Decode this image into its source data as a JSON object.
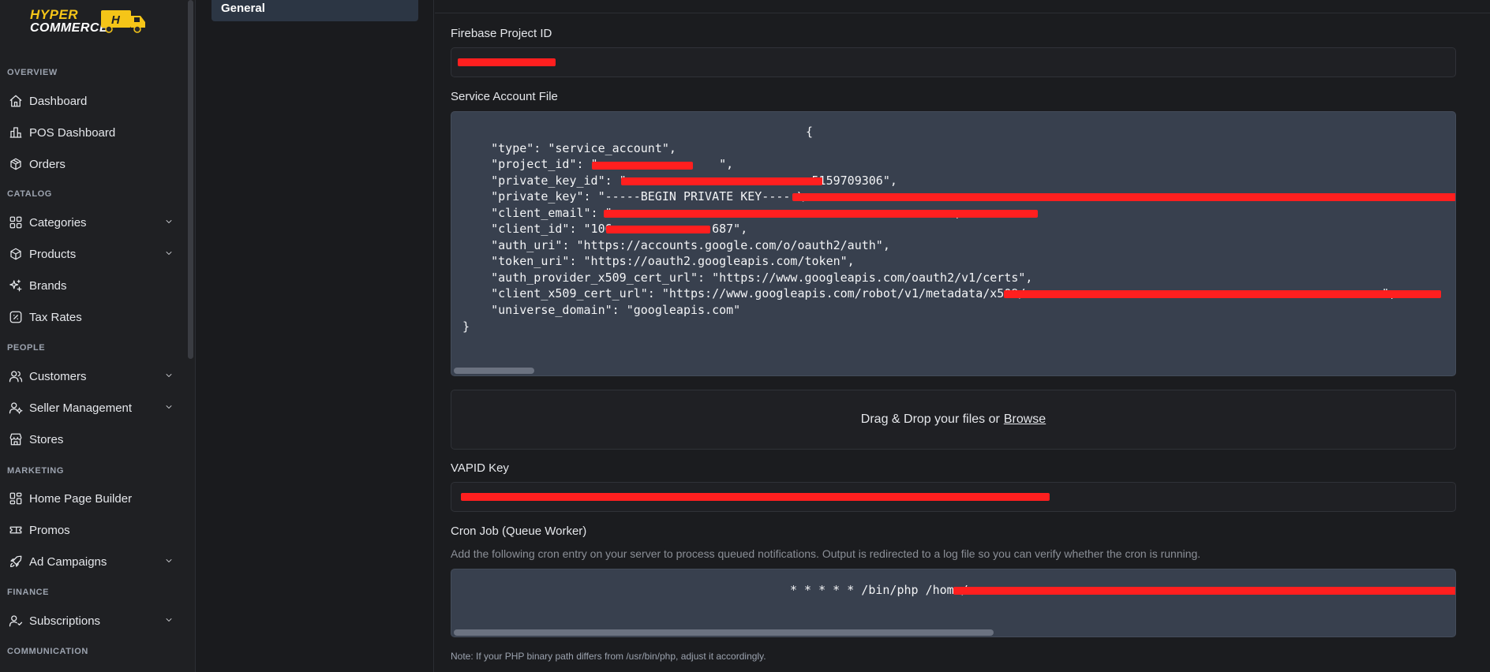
{
  "brand": {
    "line1": "HYPER",
    "line2": "COMMERCE",
    "truck_letter": "H"
  },
  "sidebar": {
    "sections": {
      "overview": "OVERVIEW",
      "catalog": "CATALOG",
      "people": "PEOPLE",
      "marketing": "MARKETING",
      "finance": "FINANCE",
      "communication": "COMMUNICATION"
    },
    "items": {
      "dashboard": "Dashboard",
      "pos_dashboard": "POS Dashboard",
      "orders": "Orders",
      "categories": "Categories",
      "products": "Products",
      "brands": "Brands",
      "tax_rates": "Tax Rates",
      "customers": "Customers",
      "seller_management": "Seller Management",
      "stores": "Stores",
      "home_page_builder": "Home Page Builder",
      "promos": "Promos",
      "ad_campaigns": "Ad Campaigns",
      "subscriptions": "Subscriptions"
    }
  },
  "settings_nav": {
    "active_item": "General"
  },
  "form": {
    "firebase_project_id_label": "Firebase Project ID",
    "service_account_label": "Service Account File",
    "service_account_json": {
      "open": "{",
      "type": "    \"type\": \"service_account\",",
      "project_id": "    \"project_id\": \"                 \",",
      "private_key_id": "    \"private_key_id\": \"                          5159709306\",",
      "private_key": "    \"private_key\": \"-----BEGIN PRIVATE KEY-----\\",
      "client_email": "    \"client_email\": \"                                                ,",
      "client_id": "    \"client_id\": \"106              687\",",
      "auth_uri": "    \"auth_uri\": \"https://accounts.google.com/o/oauth2/auth\",",
      "token_uri": "    \"token_uri\": \"https://oauth2.googleapis.com/token\",",
      "auth_provider": "    \"auth_provider_x509_cert_url\": \"https://www.googleapis.com/oauth2/v1/certs\",",
      "client_cert": "    \"client_x509_cert_url\": \"https://www.googleapis.com/robot/v1/metadata/x509/                                                  \",",
      "universe_domain": "    \"universe_domain\": \"googleapis.com\"",
      "close": "}"
    },
    "dropzone_text": "Drag & Drop your files or",
    "dropzone_link": "Browse",
    "vapid_label": "VAPID Key",
    "cron_label": "Cron Job (Queue Worker)",
    "cron_help": "Add the following cron entry on your server to process queued notifications. Output is redirected to a log file so you can verify whether the cron is running.",
    "cron_command": "* * * * * /bin/php /home/",
    "note": "Note: If your PHP binary path differs from /usr/bin/php, adjust it accordingly."
  },
  "colors": {
    "accent_yellow": "#f5c518",
    "redaction": "#ff1f1f",
    "code_bg": "#38404e"
  }
}
